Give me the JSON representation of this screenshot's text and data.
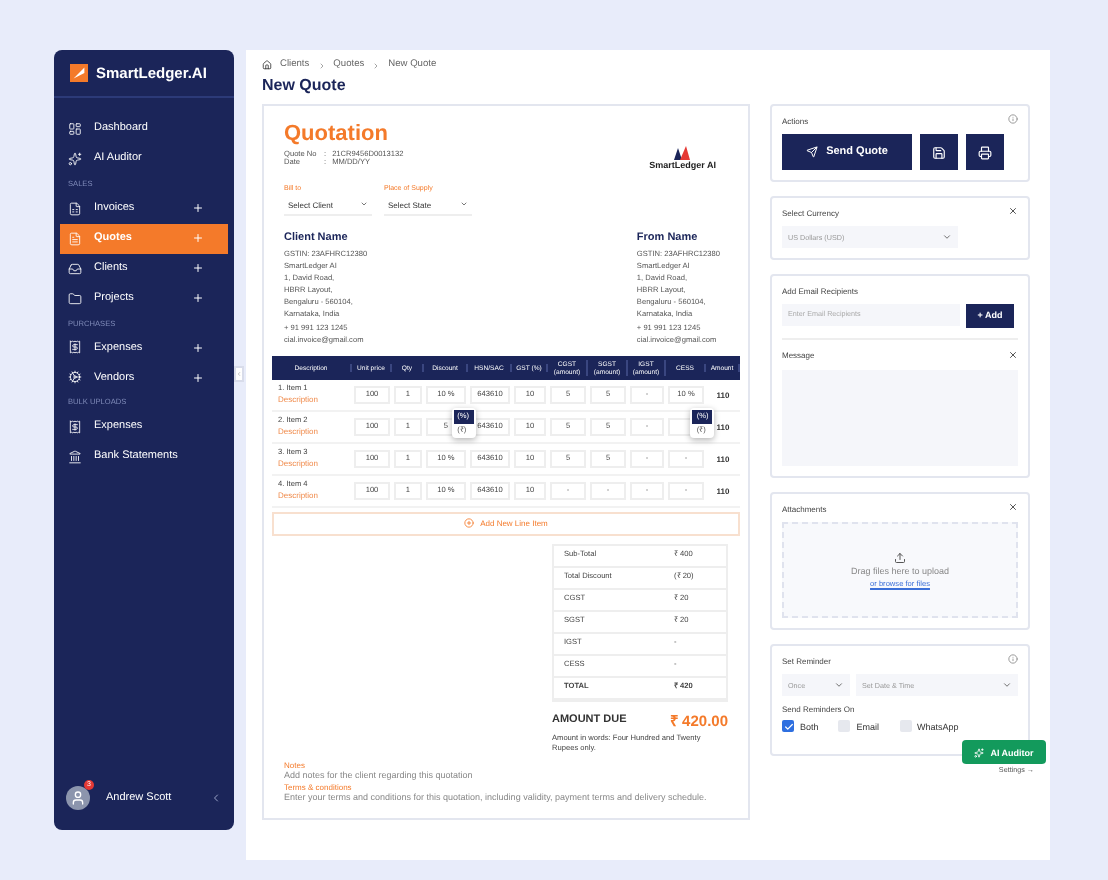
{
  "sidebar": {
    "brand": "SmartLedger.AI",
    "items": [
      {
        "kind": "link",
        "label": "Dashboard",
        "addable": false,
        "selected": false
      },
      {
        "kind": "link",
        "label": "AI Auditor",
        "addable": false,
        "selected": false
      },
      {
        "kind": "heading",
        "label": "SALES"
      },
      {
        "kind": "link",
        "label": "Invoices",
        "addable": true,
        "selected": false
      },
      {
        "kind": "link",
        "label": "Quotes",
        "addable": true,
        "selected": true
      },
      {
        "kind": "link",
        "label": "Clients",
        "addable": true,
        "selected": false
      },
      {
        "kind": "link",
        "label": "Projects",
        "addable": true,
        "selected": false
      },
      {
        "kind": "heading",
        "label": "PURCHASES"
      },
      {
        "kind": "link",
        "label": "Expenses",
        "addable": true,
        "selected": false
      },
      {
        "kind": "link",
        "label": "Vendors",
        "addable": true,
        "selected": false
      },
      {
        "kind": "heading",
        "label": "BULK UPLOADS"
      },
      {
        "kind": "link",
        "label": "Expenses",
        "addable": false,
        "selected": false
      },
      {
        "kind": "link",
        "label": "Bank Statements",
        "addable": false,
        "selected": false
      }
    ],
    "user": {
      "name": "Andrew Scott",
      "badge": "3"
    }
  },
  "breadcrumb": [
    "Clients",
    "Quotes",
    "New Quote"
  ],
  "title": "New Quote",
  "quote": {
    "heading": "Quotation",
    "fields": [
      {
        "label": "Quote No",
        "separator": ":",
        "value": "21CR9456D0013132"
      },
      {
        "label": "Date",
        "separator": ":",
        "value": "MM/DD/YY"
      }
    ],
    "logo_text": "SmartLedger AI",
    "selects": [
      {
        "label": "Bill to",
        "value": "Select Client"
      },
      {
        "label": "Place of Supply",
        "value": "Select State"
      }
    ],
    "parties": [
      {
        "heading": "Client Name",
        "lines": [
          "GSTIN: 23AFHRC12380",
          "SmartLedger AI",
          "1, David Road,",
          "HBRR Layout,",
          "Bengaluru - 560104,",
          "Karnataka, India",
          "+ 91 991 123 1245",
          "cial.invoice@gmail.com"
        ]
      },
      {
        "heading": "From Name",
        "lines": [
          "GSTIN: 23AFHRC12380",
          "SmartLedger AI",
          "1, David Road,",
          "HBRR Layout,",
          "Bengaluru - 560104,",
          "Karnataka, India",
          "+ 91 991 123 1245",
          "cial.invoice@gmail.com"
        ]
      }
    ],
    "description_column": "Description",
    "columns": [
      "Unit price",
      "Qty",
      "Discount",
      "HSN/SAC",
      "GST (%)",
      "CGST (amount)",
      "SGST (amount)",
      "IGST (amount)",
      "CESS",
      "Amount"
    ],
    "rows": [
      {
        "name": "1. Item 1",
        "note": "Description",
        "cells": [
          "100",
          "1",
          "10 %",
          "643610",
          "10",
          "5",
          "5",
          "-",
          "10 %",
          "110"
        ],
        "discount_menu": [
          {
            "label": "(%)",
            "selected": true
          },
          {
            "label": "(₹)",
            "selected": false
          }
        ],
        "cess_menu": [
          {
            "label": "(%)",
            "selected": true
          },
          {
            "label": "(₹)",
            "selected": false
          }
        ]
      },
      {
        "name": "2. Item 2",
        "note": "Description",
        "cells": [
          "100",
          "1",
          "5",
          "643610",
          "10",
          "5",
          "5",
          "-",
          "",
          "110"
        ]
      },
      {
        "name": "3. Item 3",
        "note": "Description",
        "cells": [
          "100",
          "1",
          "10 %",
          "643610",
          "10",
          "5",
          "5",
          "-",
          "-",
          "110"
        ]
      },
      {
        "name": "4. Item 4",
        "note": "Description",
        "cells": [
          "100",
          "1",
          "10 %",
          "643610",
          "10",
          "-",
          "-",
          "-",
          "-",
          "110"
        ]
      }
    ],
    "add_line": "Add New Line Item",
    "totals": [
      {
        "label": "Sub-Total",
        "value": "₹ 400"
      },
      {
        "label": "Total Discount",
        "value": "(₹ 20)"
      },
      {
        "label": "CGST",
        "value": "₹ 20"
      },
      {
        "label": "SGST",
        "value": "₹ 20"
      },
      {
        "label": "IGST",
        "value": "-"
      },
      {
        "label": "CESS",
        "value": "-"
      },
      {
        "label": "TOTAL",
        "value": "₹ 420"
      }
    ],
    "amount_due": {
      "label": "AMOUNT DUE",
      "value": "₹ 420.00"
    },
    "amount_words": "Amount in words: Four Hundred and Twenty Rupees only.",
    "notes": [
      {
        "heading": "Notes",
        "text": "Add notes for the client regarding this quotation"
      },
      {
        "heading": "Terms & conditions",
        "text": "Enter your terms and conditions for this quotation, including validity, payment terms and delivery schedule."
      }
    ]
  },
  "panel": {
    "actions_label": "Actions",
    "send_label": "Send Quote",
    "currency": {
      "label": "Select Currency",
      "value": "US Dollars (USD)"
    },
    "recipients": {
      "label": "Add Email Recipients",
      "placeholder": "Enter Email Recipients",
      "button": "+ Add"
    },
    "message": {
      "label": "Message"
    },
    "attachments": {
      "label": "Attachments",
      "hint": "Drag files here to upload",
      "link": "or browse for files"
    },
    "reminder": {
      "label": "Set Reminder",
      "frequency": "Once",
      "datetime": "Set Date & Time",
      "channels_label": "Send Reminders On",
      "channels": [
        {
          "label": "Both",
          "checked": true
        },
        {
          "label": "Email",
          "checked": false
        },
        {
          "label": "WhatsApp",
          "checked": false
        }
      ]
    },
    "auditor_button": "AI Auditor",
    "settings_link": "Settings →"
  }
}
